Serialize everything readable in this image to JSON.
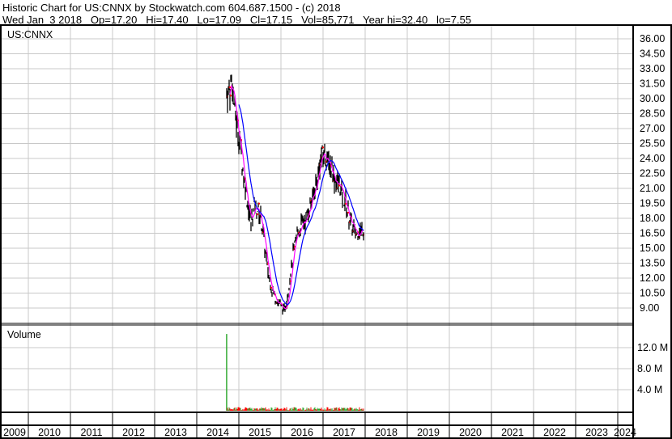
{
  "header": {
    "title": "Historic Chart for US:CNNX by Stockwatch.com 604.687.1500 - (c) 2018",
    "quote": "Wed Jan  3 2018   Op=17.20   Hi=17.40   Lo=17.09   Cl=17.15   Vol=85,771   Year hi=32.40   lo=7.55"
  },
  "chart_data": {
    "type": "line",
    "title": "US:CNNX",
    "volume_label": "Volume",
    "x_ticks": [
      "2009",
      "2010",
      "2011",
      "2012",
      "2013",
      "2014",
      "2015",
      "2016",
      "2017",
      "2018",
      "2019",
      "2020",
      "2021",
      "2022",
      "2023",
      "2024"
    ],
    "price_ticks": [
      "36.00",
      "34.50",
      "33.00",
      "31.50",
      "30.00",
      "28.50",
      "27.00",
      "25.50",
      "24.00",
      "22.50",
      "21.00",
      "19.50",
      "18.00",
      "16.50",
      "15.00",
      "13.50",
      "12.00",
      "10.50",
      "9.00"
    ],
    "price_ylim": [
      9.0,
      36.0
    ],
    "volume_ticks": [
      "12.0 M",
      "8.0 M",
      "4.0 M"
    ],
    "volume_ylim_millions": [
      0,
      12
    ],
    "xlim_years": [
      2010,
      2024
    ],
    "price_series": {
      "x": [
        2014.71,
        2014.83,
        2014.9,
        2015.02,
        2015.1,
        2015.19,
        2015.29,
        2015.38,
        2015.48,
        2015.58,
        2015.67,
        2015.77,
        2015.87,
        2015.96,
        2016.06,
        2016.13,
        2016.21,
        2016.29,
        2016.38,
        2016.48,
        2016.6,
        2016.71,
        2016.83,
        2016.92,
        2017.02,
        2017.12,
        2017.21,
        2017.31,
        2017.4,
        2017.5,
        2017.6,
        2017.69,
        2017.79,
        2017.88,
        2017.98
      ],
      "close": [
        30.2,
        31.8,
        28.9,
        25.7,
        22.9,
        20.0,
        17.6,
        19.2,
        18.8,
        16.4,
        13.1,
        11.1,
        9.9,
        9.5,
        8.7,
        9.5,
        11.9,
        14.4,
        16.4,
        17.2,
        18.0,
        19.6,
        21.2,
        23.7,
        24.5,
        23.7,
        22.9,
        21.6,
        21.2,
        20.0,
        18.4,
        17.2,
        16.4,
        16.8,
        17.0
      ]
    },
    "volume_series": {
      "spike": {
        "x": 2014.71,
        "millions": 14.6
      },
      "typical_millions": 0.4
    },
    "colors": {
      "bars": "#000000",
      "close_marks": "#ff0000",
      "ma_short": "#ff00ff",
      "ma_long": "#0000ff",
      "vol_up": "#33aa33",
      "vol_down": "#ff0000",
      "grid": "#c8c8c8"
    }
  }
}
